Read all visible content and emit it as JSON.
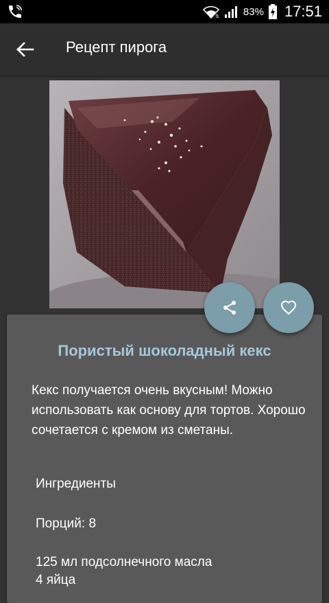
{
  "status_bar": {
    "battery_percent": "83%",
    "time": "17:51",
    "icons": [
      "phone-call-icon",
      "wifi-icon",
      "signal-icon",
      "battery-charging-icon"
    ]
  },
  "app_bar": {
    "title": "Рецепт пирога",
    "back_icon": "arrow-back-icon"
  },
  "hero_image": {
    "subject": "chocolate-cake-slice"
  },
  "actions": {
    "share_icon": "share-icon",
    "favorite_icon": "heart-outline-icon",
    "accent_color": "#7c9daa"
  },
  "recipe": {
    "title": "Пористый шоколадный кекс",
    "description": "Кекс получается очень вкусным! Можно использовать как основу для тортов. Хорошо сочетается с кремом из сметаны.",
    "ingredients_header": "Ингредиенты",
    "portions": "Порций: 8",
    "ingredients": [
      "125 мл подсолнечного масла",
      "4 яйца"
    ]
  }
}
